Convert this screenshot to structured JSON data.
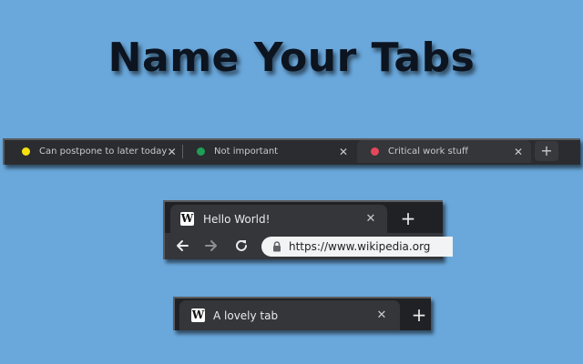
{
  "headline": "Name Your Tabs",
  "strip": {
    "tabs": [
      {
        "title": "Can postpone to later today",
        "dot_color": "#f4e10f",
        "close": "✕",
        "active": false
      },
      {
        "title": "Not important",
        "dot_color": "#1e9e56",
        "close": "✕",
        "active": false
      },
      {
        "title": "Critical work stuff",
        "dot_color": "#e5475a",
        "close": "✕",
        "active": true
      }
    ],
    "new_tab": "+"
  },
  "browser": {
    "tab": {
      "icon": "W",
      "title": "Hello World!",
      "close": "✕"
    },
    "new_tab": "+",
    "url": "https://www.wikipedia.org"
  },
  "lone": {
    "tab": {
      "icon": "W",
      "title": "A lovely tab",
      "close": "✕"
    },
    "new_tab": "+"
  },
  "colors": {
    "background": "#6aa8dc",
    "tab_bg": "#35363a",
    "frame_bg": "#202124"
  }
}
